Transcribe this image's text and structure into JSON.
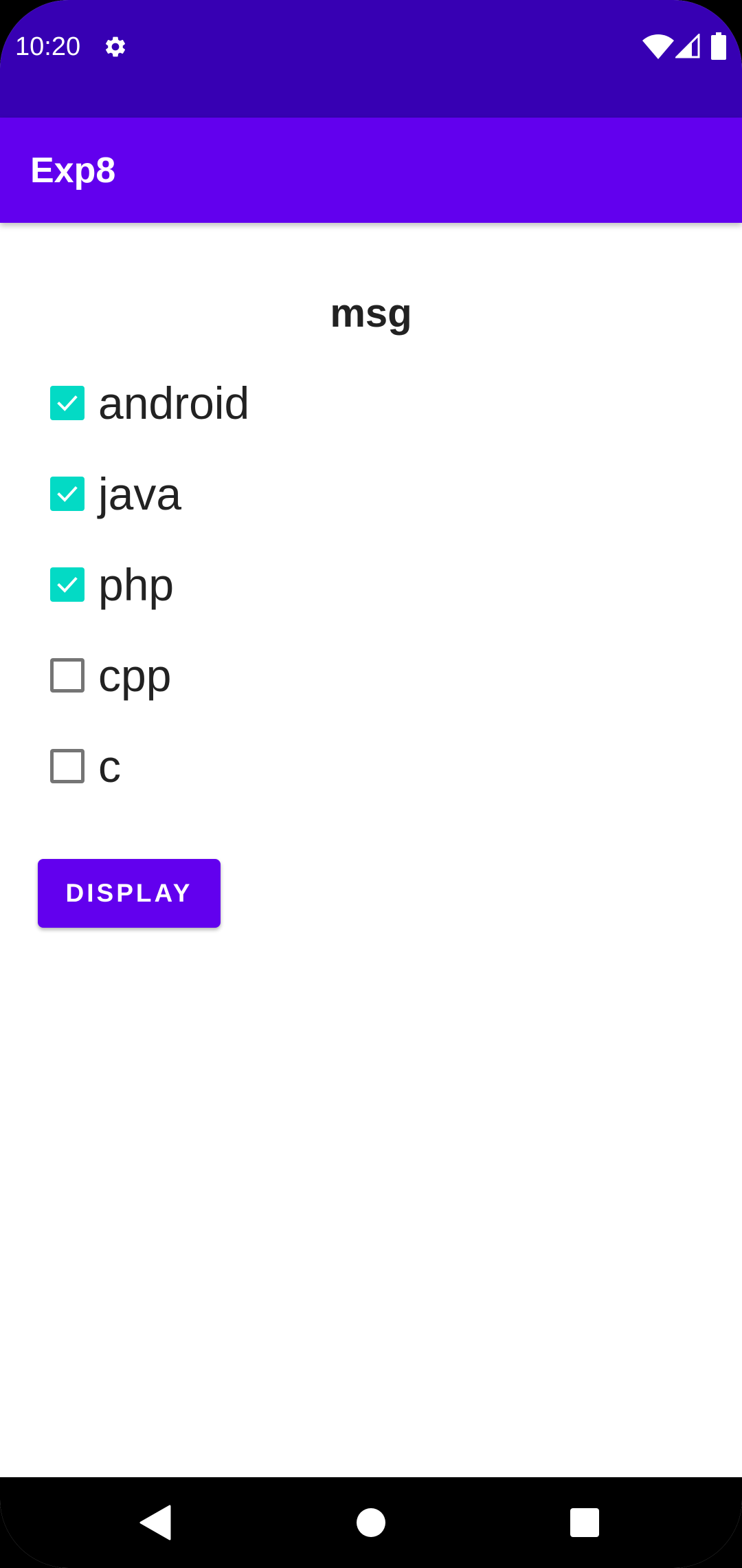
{
  "status_bar": {
    "time": "10:20",
    "icons": [
      "gear-icon",
      "wifi-icon",
      "signal-icon",
      "battery-icon"
    ]
  },
  "app_bar": {
    "title": "Exp8"
  },
  "main": {
    "message": "msg",
    "checkboxes": [
      {
        "label": "android",
        "checked": true
      },
      {
        "label": "java",
        "checked": true
      },
      {
        "label": "php",
        "checked": true
      },
      {
        "label": "cpp",
        "checked": false
      },
      {
        "label": "c",
        "checked": false
      }
    ],
    "display_button_label": "DISPLAY"
  },
  "nav_bar": {
    "icons": [
      "back-icon",
      "home-icon",
      "recents-icon"
    ]
  },
  "colors": {
    "status_bar": "#3700b3",
    "primary": "#6200ee",
    "checkbox_accent": "#03dac5",
    "checkbox_unchecked_border": "#757575",
    "text": "#222222"
  }
}
